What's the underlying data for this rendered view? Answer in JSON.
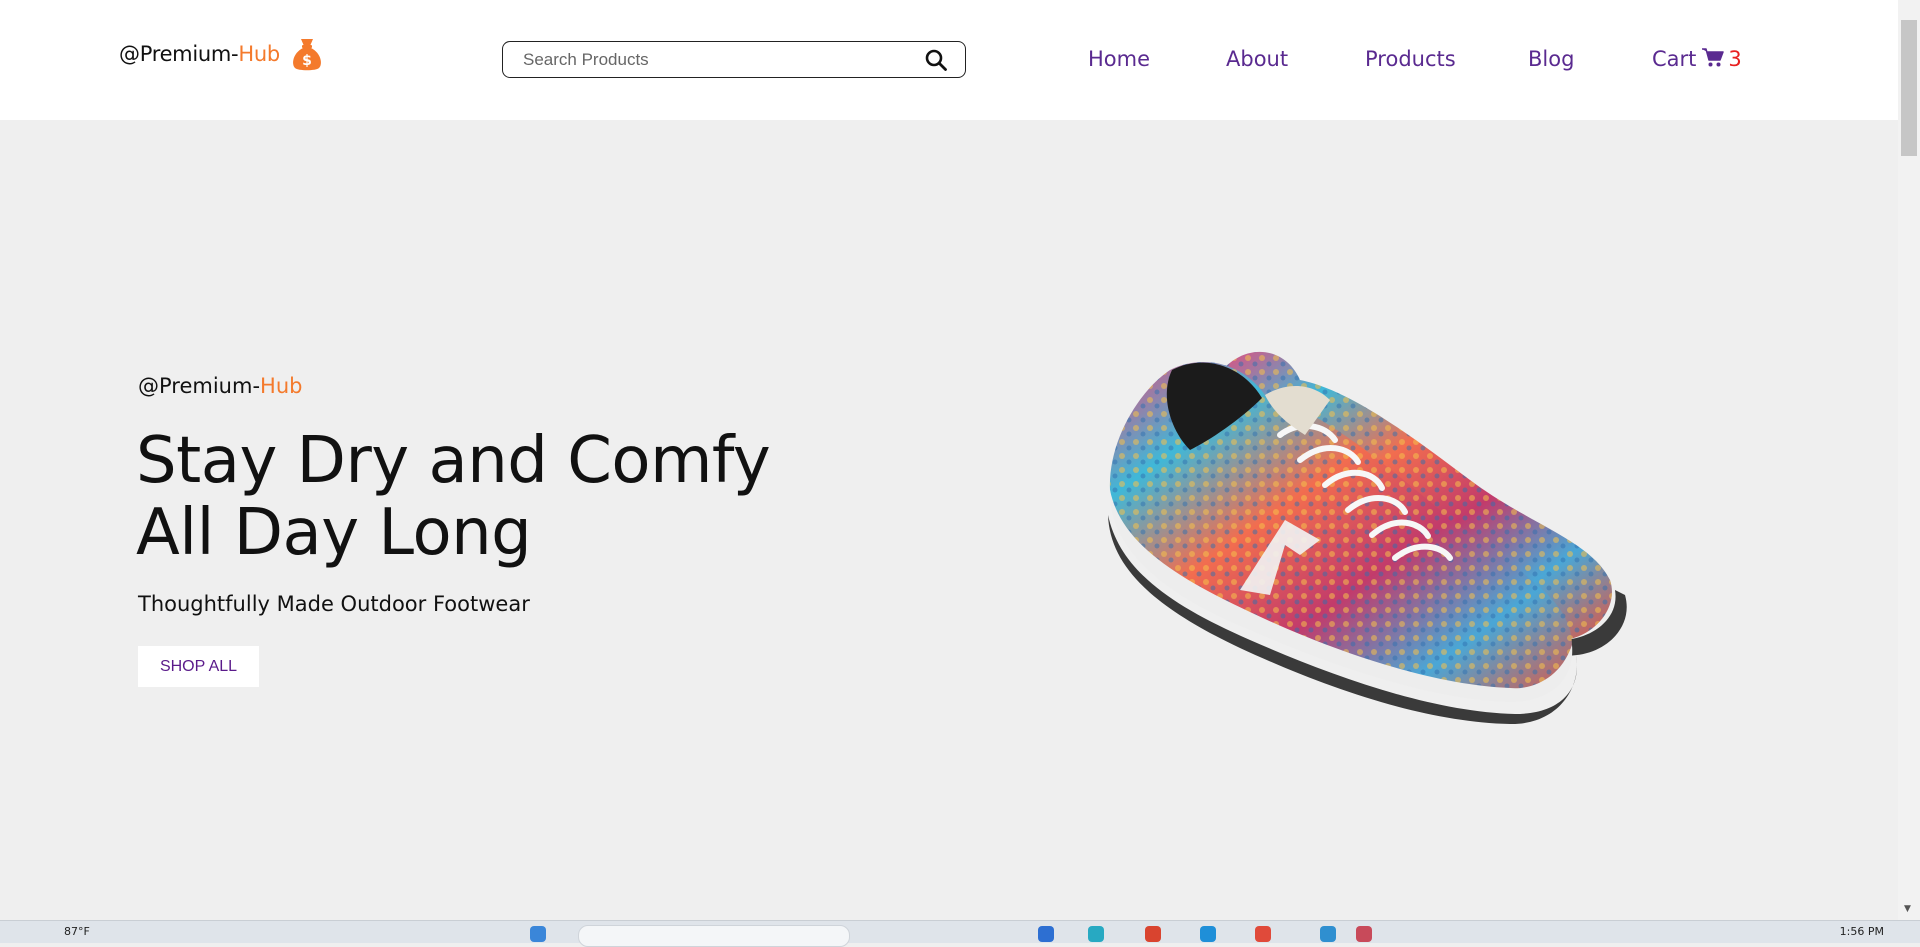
{
  "header": {
    "logo_prefix": "@Premium-",
    "logo_accent": "Hub",
    "logo_icon": "money-bag-icon"
  },
  "search": {
    "placeholder": "Search Products",
    "icon": "search-icon"
  },
  "nav": {
    "home": "Home",
    "about": "About",
    "products": "Products",
    "blog": "Blog",
    "cart": "Cart",
    "cart_icon": "shopping-cart-icon",
    "cart_count": "3"
  },
  "hero": {
    "brand_prefix": "@Premium-",
    "brand_accent": "Hub",
    "title": "Stay Dry and Comfy All Day Long",
    "subtitle": "Thoughtfully Made Outdoor Footwear",
    "cta": "SHOP ALL",
    "image": "colorful-sneakers"
  },
  "taskbar": {
    "weather": "87°F",
    "clock": "1:56 PM"
  },
  "colors": {
    "accent_orange": "#f47a2c",
    "nav_purple": "#5a2a90",
    "cart_count_red": "#e82020",
    "hero_bg": "#efefef"
  }
}
